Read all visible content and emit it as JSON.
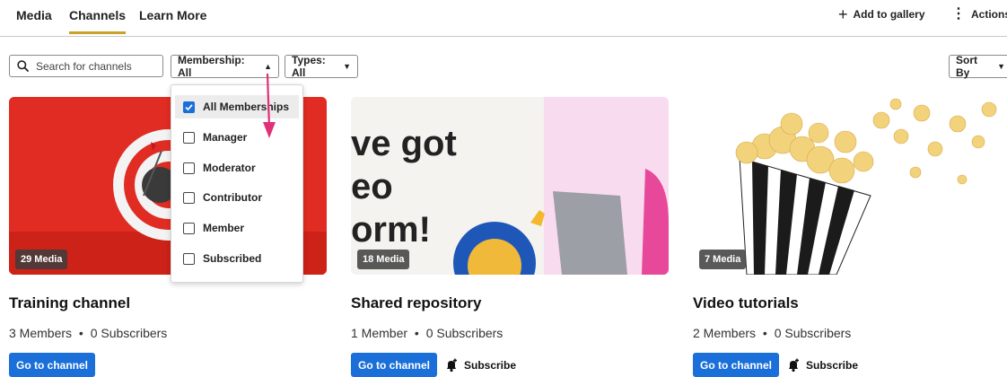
{
  "tabs": [
    {
      "label": "Media",
      "active": false
    },
    {
      "label": "Channels",
      "active": true
    },
    {
      "label": "Learn More",
      "active": false
    }
  ],
  "header_actions": {
    "add_to_gallery": "Add to gallery",
    "actions": "Actions"
  },
  "filters": {
    "search_placeholder": "Search for channels",
    "membership": "Membership: All",
    "types": "Types: All",
    "sort": "Sort By"
  },
  "membership_dropdown": {
    "options": [
      {
        "label": "All Memberships",
        "checked": true
      },
      {
        "label": "Manager",
        "checked": false
      },
      {
        "label": "Moderator",
        "checked": false
      },
      {
        "label": "Contributor",
        "checked": false
      },
      {
        "label": "Member",
        "checked": false
      },
      {
        "label": "Subscribed",
        "checked": false
      }
    ]
  },
  "channels": [
    {
      "title": "Training channel",
      "media_count": "29 Media",
      "members": "3 Members",
      "subscribers": "0 Subscribers",
      "go_label": "Go to channel",
      "subscribe_label": ""
    },
    {
      "title": "Shared repository",
      "media_count": "18 Media",
      "members": "1 Member",
      "subscribers": "0 Subscribers",
      "go_label": "Go to channel",
      "subscribe_label": "Subscribe",
      "thumb_text": [
        "ve got",
        "eo",
        "orm!"
      ]
    },
    {
      "title": "Video tutorials",
      "media_count": "7 Media",
      "members": "2 Members",
      "subscribers": "0 Subscribers",
      "go_label": "Go to channel",
      "subscribe_label": "Subscribe"
    }
  ],
  "separator": "•",
  "colors": {
    "accent": "#1a6fd8",
    "tab_underline": "#c9a227",
    "annotation_arrow": "#e0307a"
  }
}
